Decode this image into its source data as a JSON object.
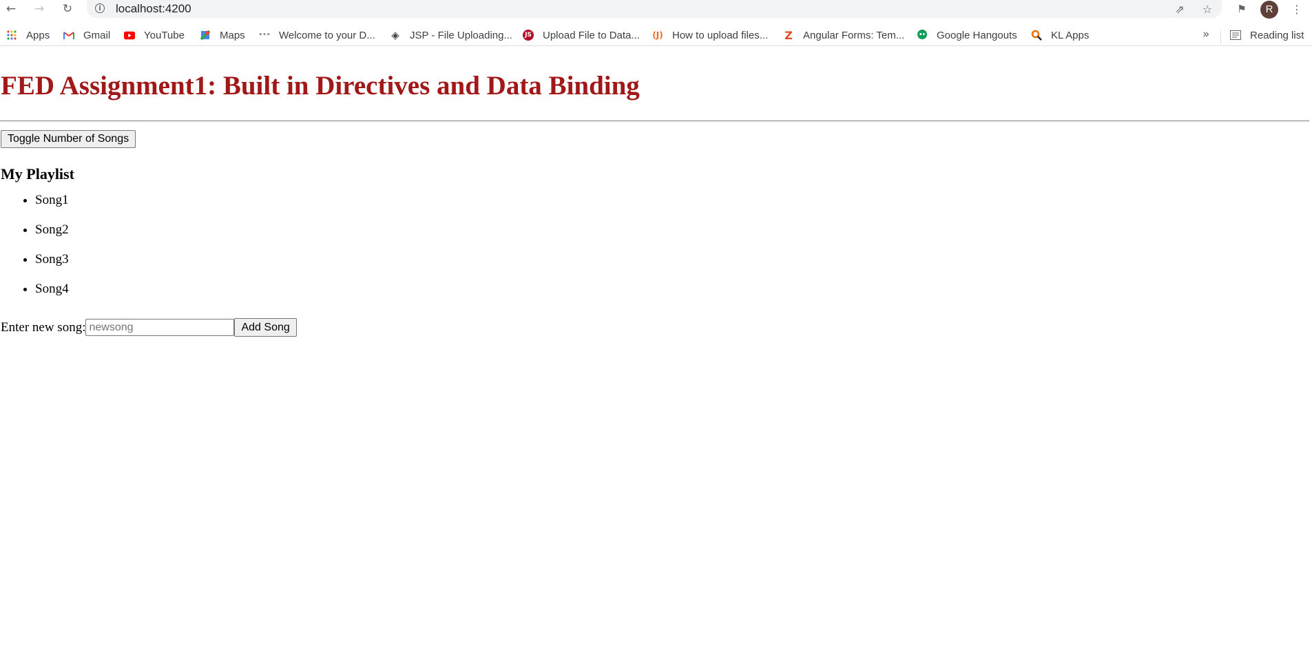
{
  "browser": {
    "url": "localhost:4200",
    "avatar_initial": "R",
    "bookmarks": [
      {
        "label": "Apps",
        "icon": "apps-grid-icon"
      },
      {
        "label": "Gmail",
        "icon": "gmail-icon"
      },
      {
        "label": "YouTube",
        "icon": "youtube-icon"
      },
      {
        "label": "Maps",
        "icon": "maps-icon"
      },
      {
        "label": "Welcome to your D...",
        "icon": "site-favicon-icon"
      },
      {
        "label": "JSP - File Uploading...",
        "icon": "diamond-favicon-icon"
      },
      {
        "label": "Upload File to Data...",
        "icon": "red-circle-favicon-icon"
      },
      {
        "label": "How to upload files...",
        "icon": "j-favicon-icon"
      },
      {
        "label": "Angular Forms: Tem...",
        "icon": "z-favicon-icon"
      },
      {
        "label": "Google Hangouts",
        "icon": "hangouts-icon"
      },
      {
        "label": "KL Apps",
        "icon": "search-favicon-icon"
      }
    ],
    "more_bookmarks": "»",
    "reading_list": "Reading list"
  },
  "page": {
    "title": "FED Assignment1: Built in Directives and Data Binding",
    "toggle_button": "Toggle Number of Songs",
    "playlist_heading": "My Playlist",
    "songs": [
      "Song1",
      "Song2",
      "Song3",
      "Song4"
    ],
    "new_song_label": "Enter new song:",
    "new_song_placeholder": "newsong",
    "new_song_value": "",
    "add_button": "Add Song"
  },
  "colors": {
    "title": "#a01818",
    "avatar": "#5d4037"
  }
}
